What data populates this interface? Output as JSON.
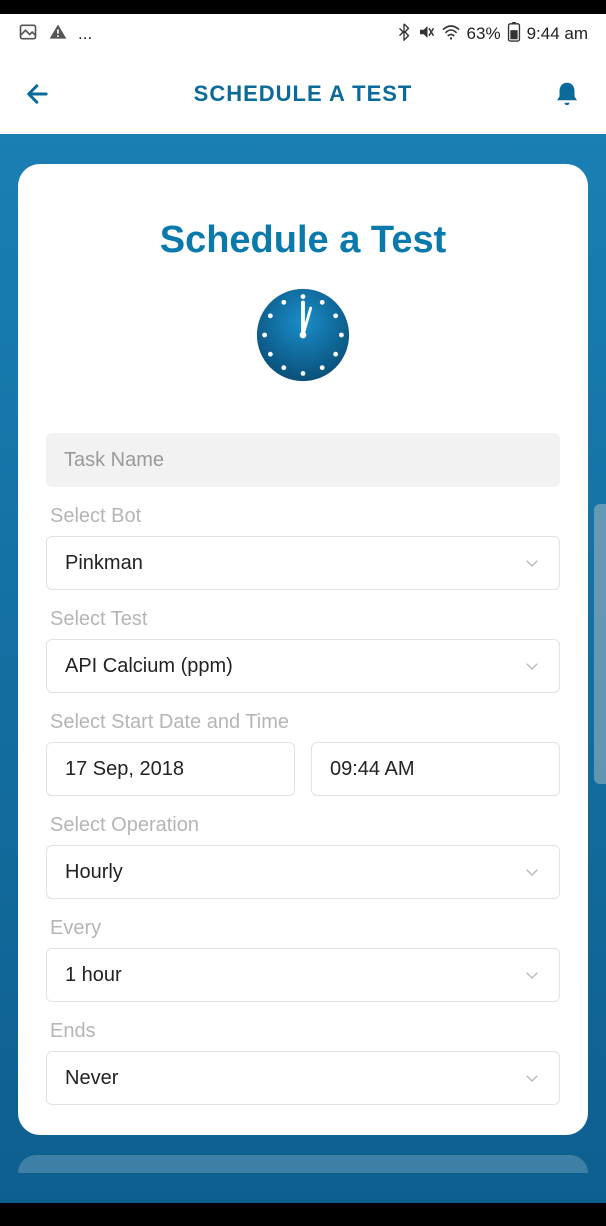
{
  "statusbar": {
    "battery": "63%",
    "time": "9:44 am",
    "ellipsis": "..."
  },
  "nav": {
    "title": "SCHEDULE A TEST"
  },
  "card": {
    "title": "Schedule a Test"
  },
  "form": {
    "task_name_placeholder": "Task Name",
    "select_bot_label": "Select Bot",
    "select_bot_value": "Pinkman",
    "select_test_label": "Select Test",
    "select_test_value": "API Calcium (ppm)",
    "start_datetime_label": "Select Start Date and Time",
    "start_date_value": "17 Sep, 2018",
    "start_time_value": "09:44 AM",
    "operation_label": "Select Operation",
    "operation_value": "Hourly",
    "every_label": "Every",
    "every_value": "1 hour",
    "ends_label": "Ends",
    "ends_value": "Never"
  }
}
